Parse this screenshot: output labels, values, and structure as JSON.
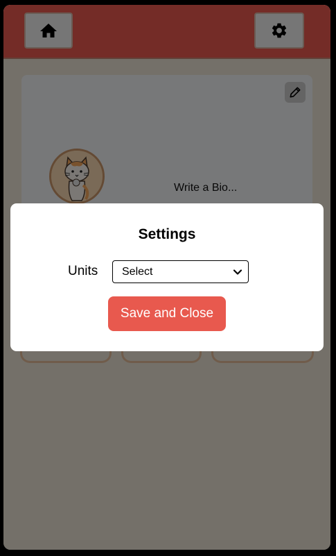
{
  "header": {
    "home_icon": "home-icon",
    "settings_icon": "gear-icon",
    "color": "#e8594e"
  },
  "profile": {
    "edit_icon": "pencil-icon",
    "avatar": "cat-avatar",
    "bio_placeholder": "Write a Bio..."
  },
  "settings_modal": {
    "title": "Settings",
    "units_label": "Units",
    "units_selected": "Select",
    "save_label": "Save and Close",
    "accent": "#e8594e"
  }
}
